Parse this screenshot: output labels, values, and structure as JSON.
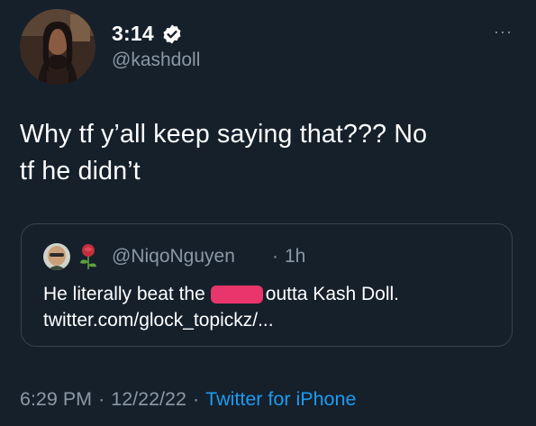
{
  "tweet": {
    "display_name": "3:14",
    "handle": "@kashdoll",
    "avatar_icon": "profile-photo",
    "verified_icon": "verified-badge-icon",
    "more_icon": "more-options-icon",
    "more_label": "···",
    "text": "Why tf y’all keep saying that??? No\ntf he didn’t",
    "time": "6:29 PM",
    "date": "12/22/22",
    "source": "Twitter for iPhone",
    "separator": "·"
  },
  "quote": {
    "handle": "@NiqoNguyen",
    "separator": "·",
    "time": "1h",
    "text_before": "He literally beat the",
    "text_after": "outta Kash Doll.",
    "link": "twitter.com/glock_topickz/..."
  },
  "colors": {
    "background": "#15202b",
    "text": "#ffffff",
    "secondary": "#8b98a5",
    "accent": "#1d9bf0",
    "border": "#38444d",
    "redaction": "#e8356b"
  }
}
